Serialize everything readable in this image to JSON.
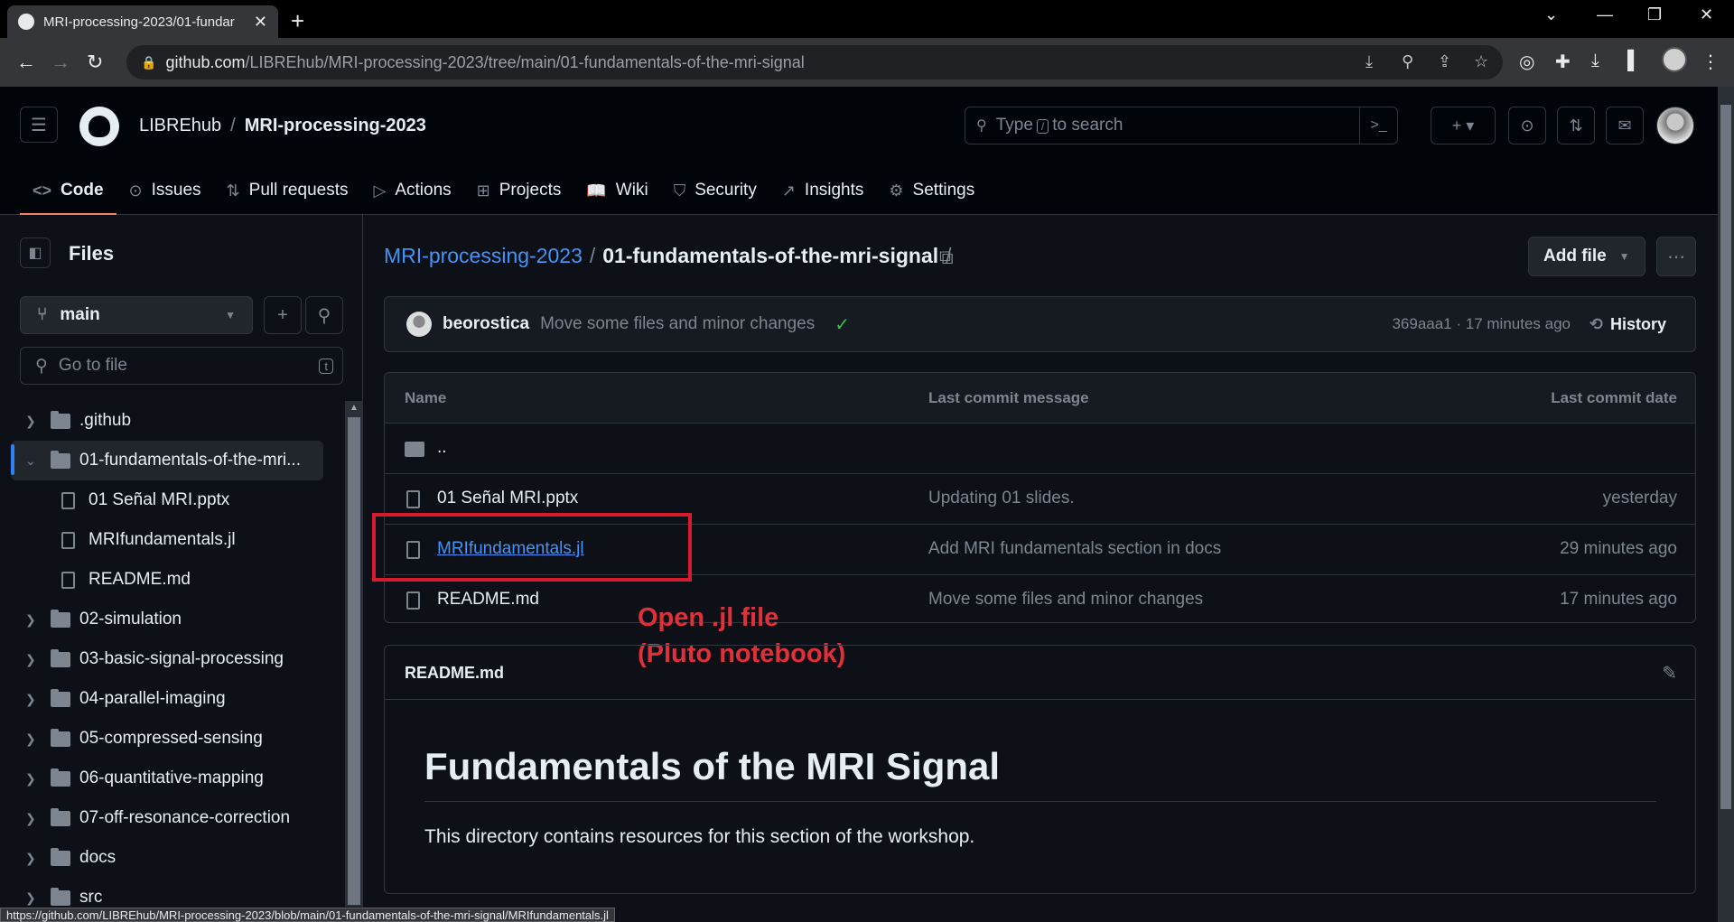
{
  "browser": {
    "tab_title": "MRI-processing-2023/01-fundar",
    "url_host": "github.com",
    "url_path": "/LIBREhub/MRI-processing-2023/tree/main/01-fundamentals-of-the-mri-signal",
    "status_url": "https://github.com/LIBREhub/MRI-processing-2023/blob/main/01-fundamentals-of-the-mri-signal/MRIfundamentals.jl"
  },
  "header": {
    "owner": "LIBREhub",
    "separator": "/",
    "repo": "MRI-processing-2023",
    "search_prefix": "Type",
    "search_key": "/",
    "search_suffix": "to search"
  },
  "nav": [
    {
      "label": "Code",
      "icon": "code-icon"
    },
    {
      "label": "Issues",
      "icon": "issues-icon"
    },
    {
      "label": "Pull requests",
      "icon": "pull-request-icon"
    },
    {
      "label": "Actions",
      "icon": "actions-icon"
    },
    {
      "label": "Projects",
      "icon": "projects-icon"
    },
    {
      "label": "Wiki",
      "icon": "wiki-icon"
    },
    {
      "label": "Security",
      "icon": "shield-icon"
    },
    {
      "label": "Insights",
      "icon": "graph-icon"
    },
    {
      "label": "Settings",
      "icon": "gear-icon"
    }
  ],
  "sidebar": {
    "title": "Files",
    "branch": "main",
    "goto_placeholder": "Go to file",
    "goto_key": "t",
    "tree": [
      {
        "label": ".github",
        "type": "folder"
      },
      {
        "label": "01-fundamentals-of-the-mri...",
        "type": "folder-open"
      },
      {
        "label": "01 Señal MRI.pptx",
        "type": "file"
      },
      {
        "label": "MRIfundamentals.jl",
        "type": "file"
      },
      {
        "label": "README.md",
        "type": "file"
      },
      {
        "label": "02-simulation",
        "type": "folder"
      },
      {
        "label": "03-basic-signal-processing",
        "type": "folder"
      },
      {
        "label": "04-parallel-imaging",
        "type": "folder"
      },
      {
        "label": "05-compressed-sensing",
        "type": "folder"
      },
      {
        "label": "06-quantitative-mapping",
        "type": "folder"
      },
      {
        "label": "07-off-resonance-correction",
        "type": "folder"
      },
      {
        "label": "docs",
        "type": "folder"
      },
      {
        "label": "src",
        "type": "folder"
      }
    ]
  },
  "main": {
    "path_repo": "MRI-processing-2023",
    "path_sep": "/",
    "path_dir": "01-fundamentals-of-the-mri-signal",
    "add_file": "Add file",
    "commit": {
      "author": "beorostica",
      "message": "Move some files and minor changes",
      "meta": "369aaa1 · 17 minutes ago",
      "history": "History"
    },
    "table": {
      "col_name": "Name",
      "col_message": "Last commit message",
      "col_date": "Last commit date",
      "parent": "..",
      "rows": [
        {
          "name": "01 Señal MRI.pptx",
          "message": "Updating 01 slides.",
          "date": "yesterday"
        },
        {
          "name": "MRIfundamentals.jl",
          "message": "Add MRI fundamentals section in docs",
          "date": "29 minutes ago"
        },
        {
          "name": "README.md",
          "message": "Move some files and minor changes",
          "date": "17 minutes ago"
        }
      ]
    },
    "annotation_line1": "Open .jl file",
    "annotation_line2": "(Pluto notebook)",
    "readme": {
      "title": "README.md",
      "heading": "Fundamentals of the MRI Signal",
      "body": "This directory contains resources for this section of the workshop."
    }
  }
}
